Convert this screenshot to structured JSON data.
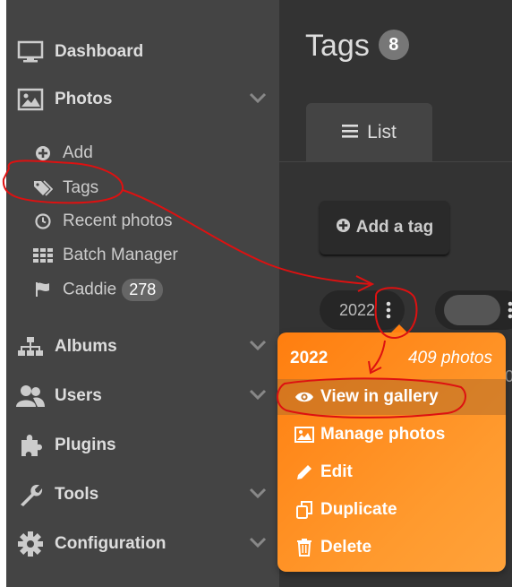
{
  "sidebar": {
    "dashboard": "Dashboard",
    "photos": "Photos",
    "photos_sub": {
      "add": "Add",
      "tags": "Tags",
      "recent": "Recent photos",
      "batch": "Batch Manager",
      "caddie": "Caddie",
      "caddie_count": "278"
    },
    "albums": "Albums",
    "users": "Users",
    "plugins": "Plugins",
    "tools": "Tools",
    "configuration": "Configuration"
  },
  "main": {
    "title": "Tags",
    "title_count": "8",
    "tab_list": "List",
    "add_tag": "Add a tag",
    "tag_name": "2022",
    "edge_text": "0"
  },
  "menu": {
    "year": "2022",
    "photos_count": "409 photos",
    "items": {
      "view": "View in gallery",
      "manage": "Manage photos",
      "edit": "Edit",
      "duplicate": "Duplicate",
      "delete": "Delete"
    }
  },
  "colors": {
    "sidebar_bg": "#444444",
    "main_bg": "#333333",
    "menu_orange": "#ff8a1f",
    "annotation_red": "#dd1111"
  }
}
